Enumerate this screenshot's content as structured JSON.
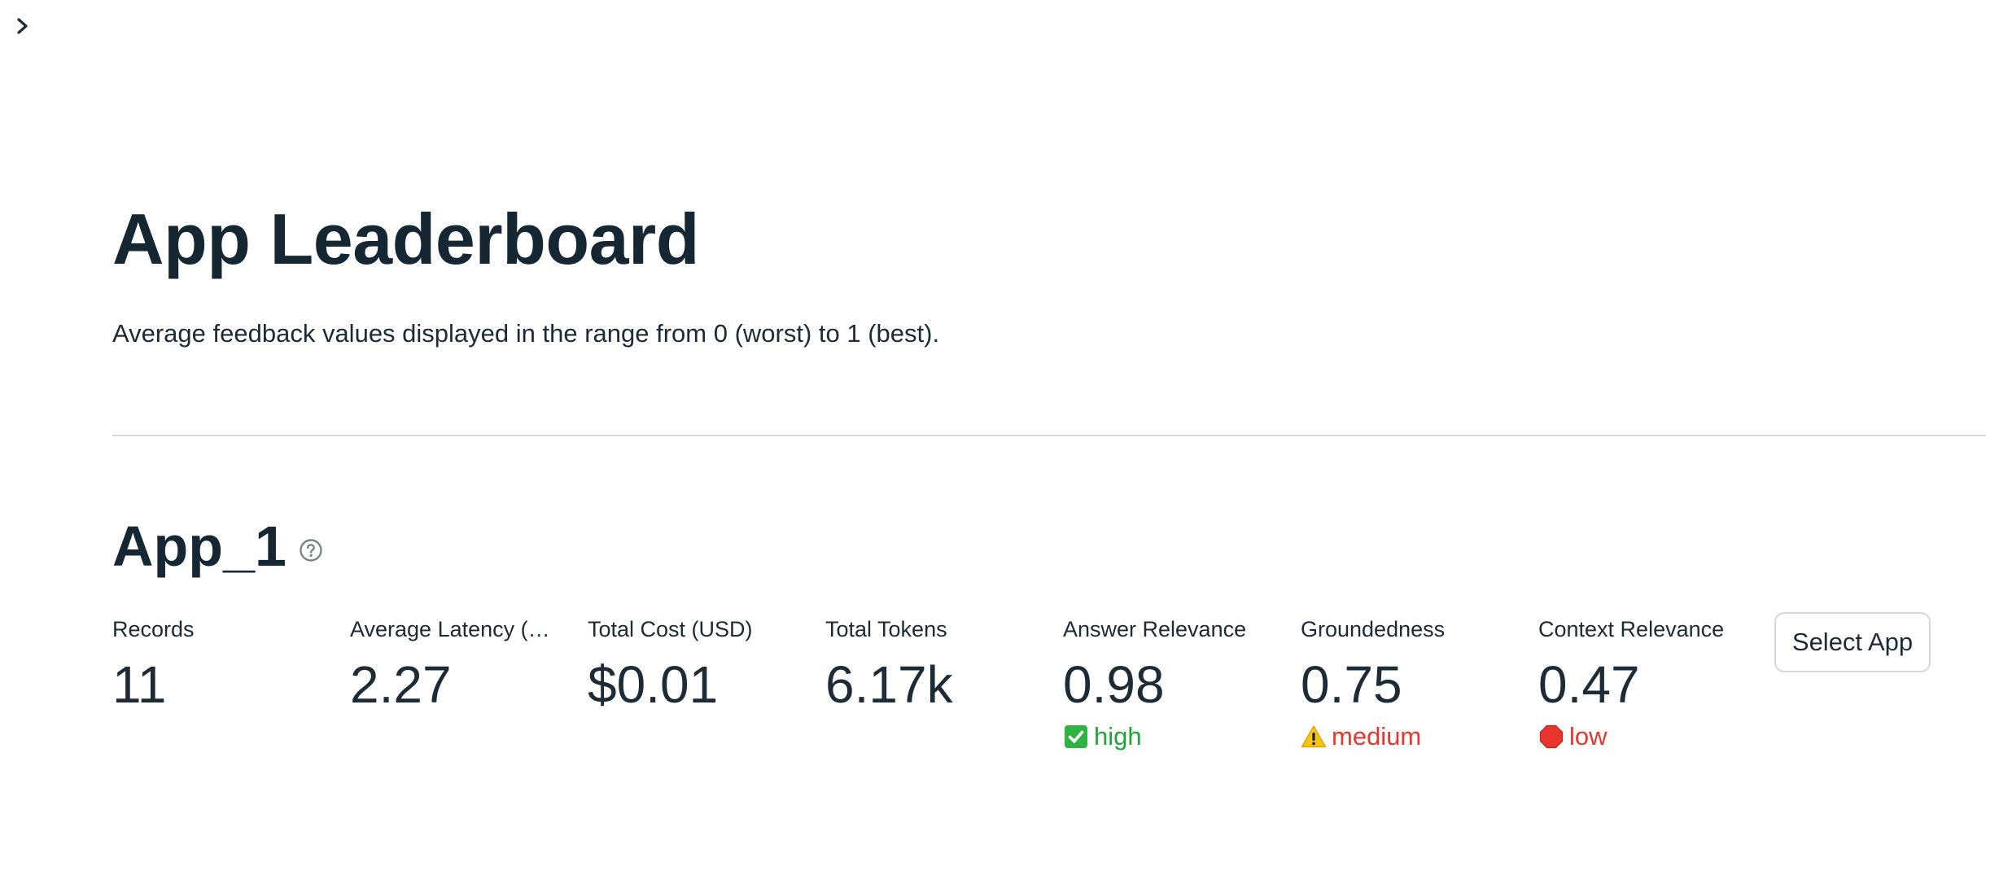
{
  "sidebar": {
    "toggle_icon": "chevron-right-icon"
  },
  "header": {
    "title": "App Leaderboard",
    "subtitle": "Average feedback values displayed in the range from 0 (worst) to 1 (best)."
  },
  "app": {
    "name": "App_1",
    "help_icon": "question-circle-icon",
    "select_button_label": "Select App",
    "metrics": [
      {
        "label": "Records",
        "value": "11"
      },
      {
        "label": "Average Latency (S…",
        "value": "2.27"
      },
      {
        "label": "Total Cost (USD)",
        "value": "$0.01"
      },
      {
        "label": "Total Tokens",
        "value": "6.17k"
      },
      {
        "label": "Answer Relevance",
        "value": "0.98",
        "delta": "high",
        "delta_icon": "check-mark-icon",
        "delta_color": "#21a33a"
      },
      {
        "label": "Groundedness",
        "value": "0.75",
        "delta": "medium",
        "delta_icon": "warning-icon",
        "delta_color": "#e8352d"
      },
      {
        "label": "Context Relevance",
        "value": "0.47",
        "delta": "low",
        "delta_icon": "stop-sign-icon",
        "delta_color": "#e8352d"
      }
    ]
  },
  "colors": {
    "text": "#1c2b36",
    "divider": "#d4d6d9",
    "positive": "#21a33a",
    "negative": "#e8352d"
  }
}
